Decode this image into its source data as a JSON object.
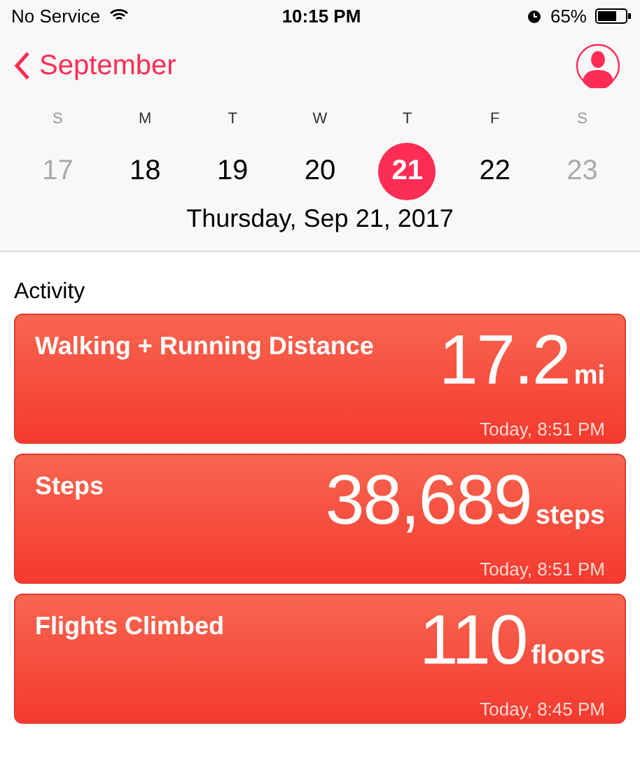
{
  "status_bar": {
    "carrier": "No Service",
    "time": "10:15 PM",
    "battery": "65%"
  },
  "nav": {
    "back": "September"
  },
  "week": [
    {
      "letter": "S",
      "day": "17",
      "dimmed": true,
      "selected": false
    },
    {
      "letter": "M",
      "day": "18",
      "dimmed": false,
      "selected": false
    },
    {
      "letter": "T",
      "day": "19",
      "dimmed": false,
      "selected": false
    },
    {
      "letter": "W",
      "day": "20",
      "dimmed": false,
      "selected": false
    },
    {
      "letter": "T",
      "day": "21",
      "dimmed": false,
      "selected": true
    },
    {
      "letter": "F",
      "day": "22",
      "dimmed": false,
      "selected": false
    },
    {
      "letter": "S",
      "day": "23",
      "dimmed": true,
      "selected": false
    }
  ],
  "date_label": "Thursday, Sep 21, 2017",
  "section_title": "Activity",
  "cards": [
    {
      "title": "Walking + Running Distance",
      "value": "17.2",
      "unit": "mi",
      "time": "Today, 8:51 PM"
    },
    {
      "title": "Steps",
      "value": "38,689",
      "unit": "steps",
      "time": "Today, 8:51 PM"
    },
    {
      "title": "Flights Climbed",
      "value": "110",
      "unit": "floors",
      "time": "Today, 8:45 PM"
    }
  ]
}
